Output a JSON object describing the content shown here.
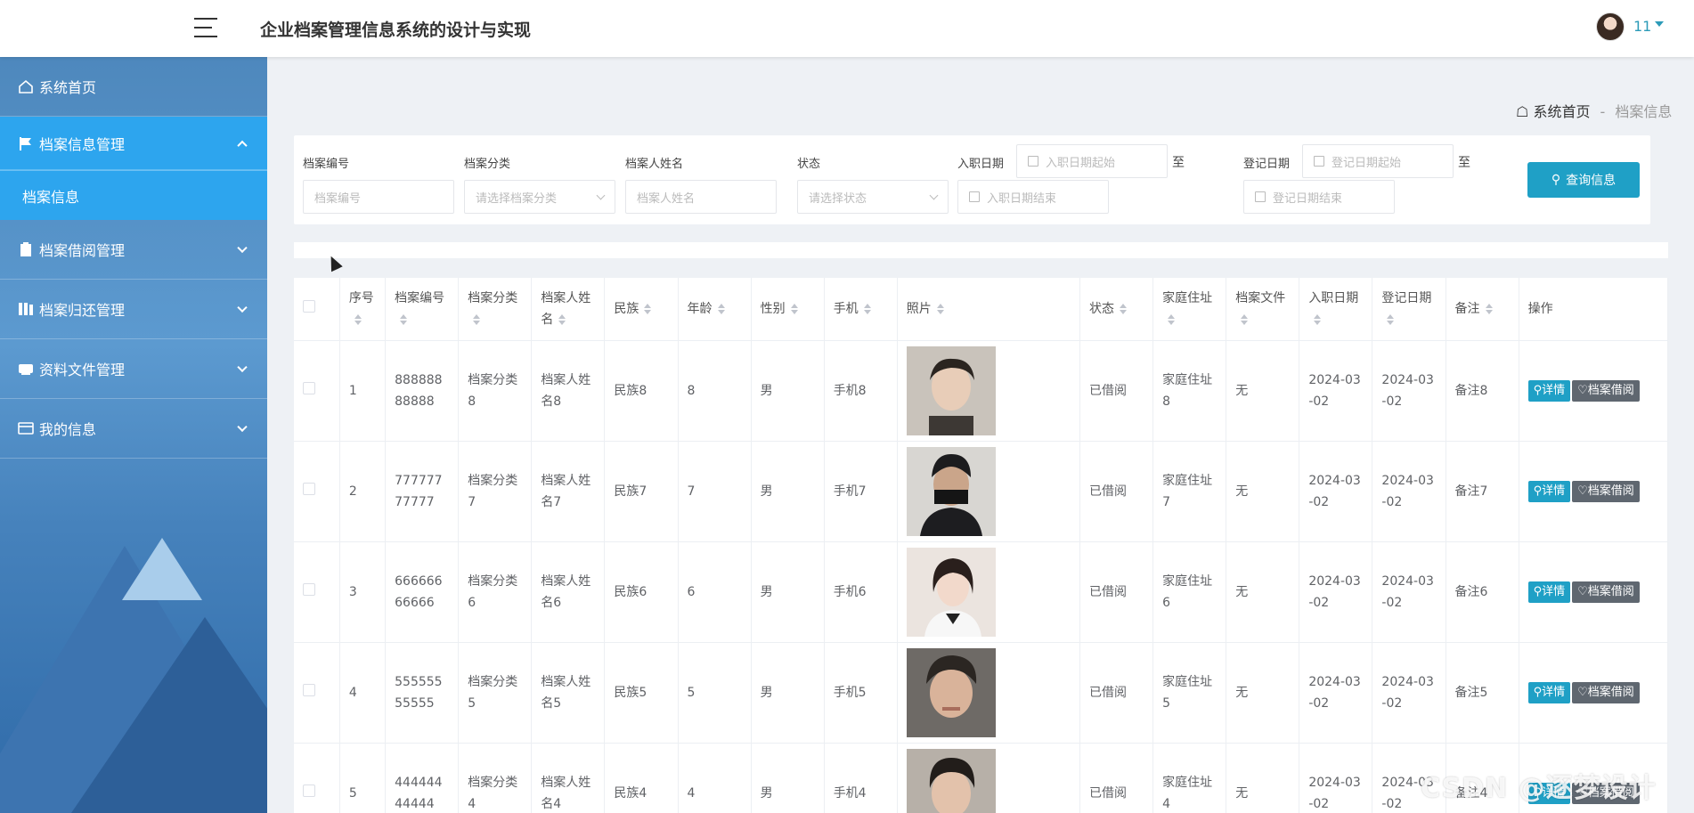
{
  "header": {
    "app_title": "企业档案管理信息系统的设计与实现",
    "user_name": "11"
  },
  "sidebar": {
    "items": [
      {
        "label": "系统首页",
        "icon": "home-icon"
      },
      {
        "label": "档案信息管理",
        "icon": "flag-icon",
        "active": true,
        "sub": [
          "档案信息"
        ]
      },
      {
        "label": "档案借阅管理",
        "icon": "clipboard-icon"
      },
      {
        "label": "档案归还管理",
        "icon": "books-icon"
      },
      {
        "label": "资料文件管理",
        "icon": "archive-icon"
      },
      {
        "label": "我的信息",
        "icon": "wallet-icon"
      }
    ]
  },
  "breadcrumb": {
    "home": "系统首页",
    "sep": "-",
    "current": "档案信息"
  },
  "filter": {
    "archive_no_label": "档案编号",
    "archive_no_placeholder": "档案编号",
    "category_label": "档案分类",
    "category_placeholder": "请选择档案分类",
    "name_label": "档案人姓名",
    "name_placeholder": "档案人姓名",
    "status_label": "状态",
    "status_placeholder": "请选择状态",
    "join_date_label": "入职日期",
    "join_start_placeholder": "入职日期起始",
    "join_end_placeholder": "入职日期结束",
    "to": "至",
    "reg_date_label": "登记日期",
    "reg_start_placeholder": "登记日期起始",
    "reg_end_placeholder": "登记日期结束",
    "query_button": "查询信息"
  },
  "table": {
    "headers": [
      "序号",
      "档案编号",
      "档案分类",
      "档案人姓名",
      "民族",
      "年龄",
      "性别",
      "手机",
      "照片",
      "状态",
      "家庭住址",
      "档案文件",
      "入职日期",
      "登记日期",
      "备注",
      "操作"
    ],
    "detail_label": "详情",
    "borrow_label": "档案借阅",
    "rows": [
      {
        "seq": "1",
        "no": "88888888888",
        "category": "档案分类8",
        "name": "档案人姓名8",
        "nation": "民族8",
        "age": "8",
        "gender": "男",
        "phone": "手机8",
        "status": "已借阅",
        "address": "家庭住址8",
        "file": "无",
        "join_date": "2024-03-02",
        "reg_date": "2024-03-02",
        "remark": "备注8"
      },
      {
        "seq": "2",
        "no": "77777777777",
        "category": "档案分类7",
        "name": "档案人姓名7",
        "nation": "民族7",
        "age": "7",
        "gender": "男",
        "phone": "手机7",
        "status": "已借阅",
        "address": "家庭住址7",
        "file": "无",
        "join_date": "2024-03-02",
        "reg_date": "2024-03-02",
        "remark": "备注7"
      },
      {
        "seq": "3",
        "no": "66666666666",
        "category": "档案分类6",
        "name": "档案人姓名6",
        "nation": "民族6",
        "age": "6",
        "gender": "男",
        "phone": "手机6",
        "status": "已借阅",
        "address": "家庭住址6",
        "file": "无",
        "join_date": "2024-03-02",
        "reg_date": "2024-03-02",
        "remark": "备注6"
      },
      {
        "seq": "4",
        "no": "55555555555",
        "category": "档案分类5",
        "name": "档案人姓名5",
        "nation": "民族5",
        "age": "5",
        "gender": "男",
        "phone": "手机5",
        "status": "已借阅",
        "address": "家庭住址5",
        "file": "无",
        "join_date": "2024-03-02",
        "reg_date": "2024-03-02",
        "remark": "备注5"
      },
      {
        "seq": "5",
        "no": "44444444444",
        "category": "档案分类4",
        "name": "档案人姓名4",
        "nation": "民族4",
        "age": "4",
        "gender": "男",
        "phone": "手机4",
        "status": "已借阅",
        "address": "家庭住址4",
        "file": "无",
        "join_date": "2024-03-02",
        "reg_date": "2024-03-02",
        "remark": "备注4"
      }
    ]
  },
  "watermark": "CSDN @逐梦设计",
  "colors": {
    "accent": "#1fa0c6",
    "menu_active": "#2da5ee",
    "sidebar": "#4e88bd",
    "borrow_button": "#5f6770"
  }
}
